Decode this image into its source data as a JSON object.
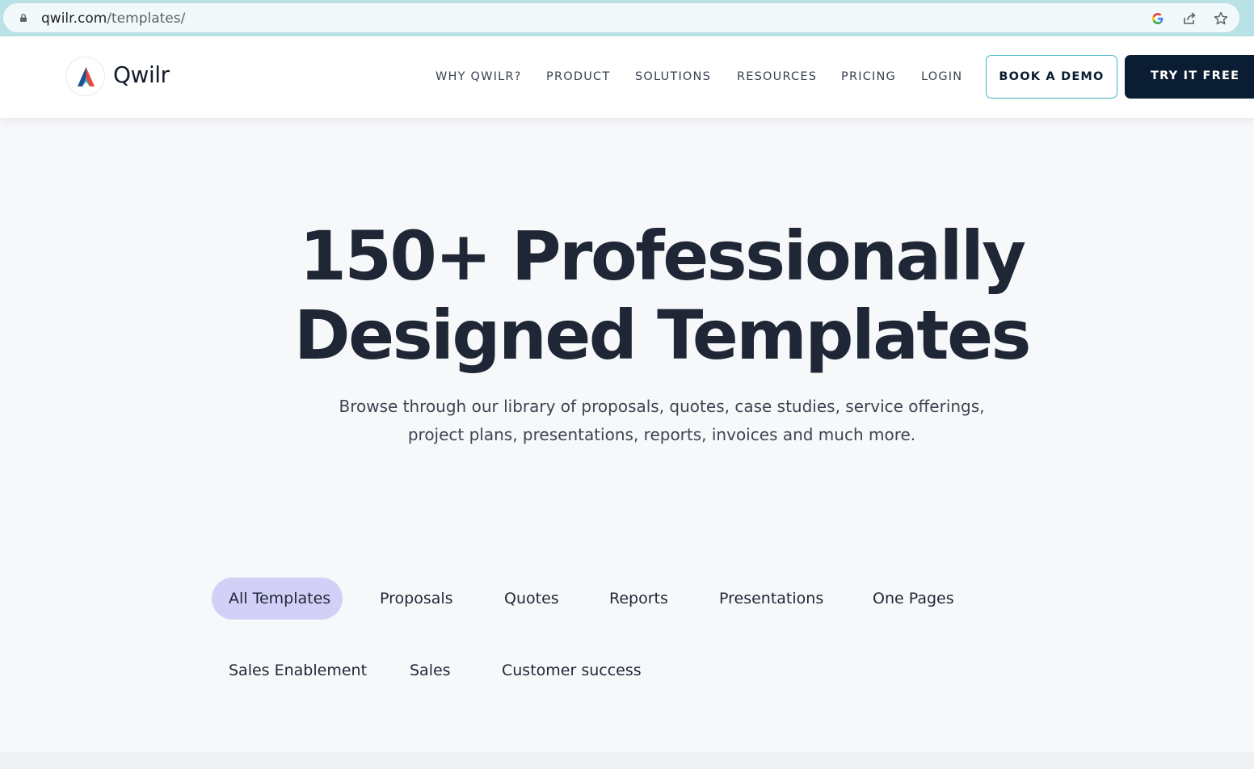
{
  "browser": {
    "url_host": "qwilr.com",
    "url_path": "/templates/",
    "icons": [
      "lock-icon",
      "google-icon",
      "share-icon",
      "bookmark-star-icon"
    ]
  },
  "header": {
    "logo_text": "Qwilr",
    "nav": [
      "WHY QWILR?",
      "PRODUCT",
      "SOLUTIONS",
      "RESOURCES",
      "PRICING",
      "LOGIN"
    ],
    "book_demo_label": "BOOK A DEMO",
    "try_free_label": "TRY IT FREE"
  },
  "hero": {
    "title_line1": "150+ Professionally",
    "title_line2": "Designed Templates",
    "subtitle_line1": "Browse through our library of proposals, quotes, case studies, service offerings,",
    "subtitle_line2": "project plans, presentations, reports, invoices and much more."
  },
  "filters": {
    "active": "All Templates",
    "items": [
      "All Templates",
      "Proposals",
      "Quotes",
      "Reports",
      "Presentations",
      "One Pages",
      "Sales Enablement",
      "Sales",
      "Customer success"
    ]
  },
  "colors": {
    "accent_pill": "#d2d0f7",
    "primary_dark": "#0b1d32",
    "demo_border": "#3fb6c8"
  }
}
